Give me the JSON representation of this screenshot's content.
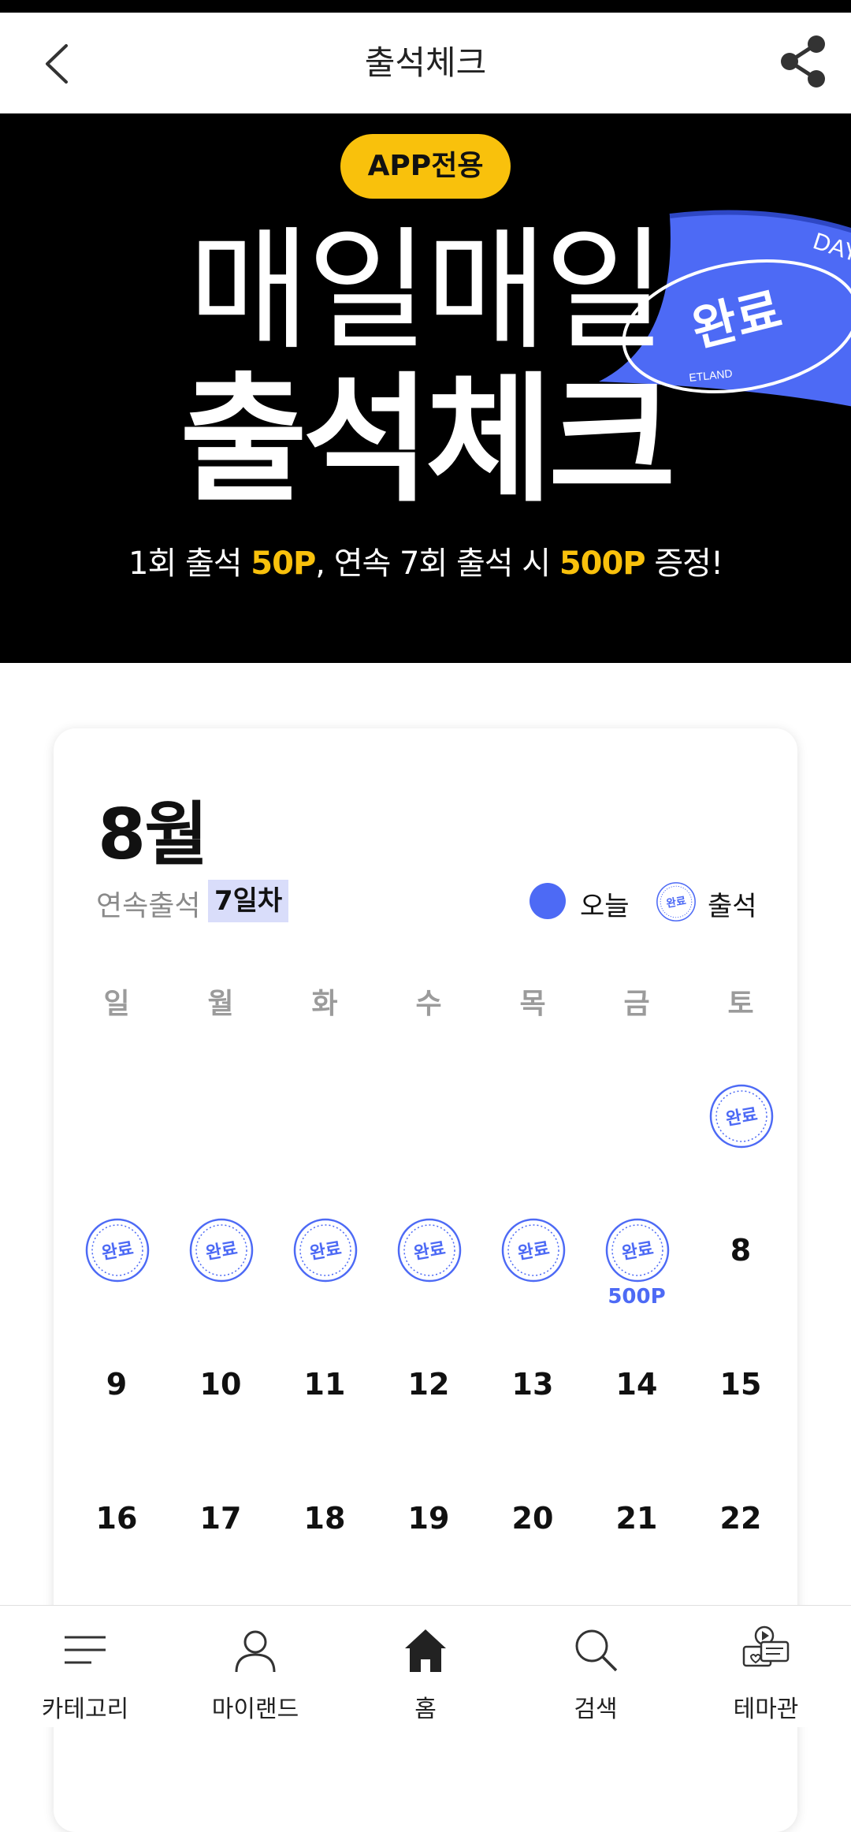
{
  "header": {
    "title": "출석체크"
  },
  "banner": {
    "badge": "APP전용",
    "line1": "매일매일",
    "line2": "출석체크",
    "sub_part1": "1회 출석 ",
    "sub_hl1": "50P",
    "sub_part2": ", 연속 7회 출석 시 ",
    "sub_hl2": "500P",
    "sub_part3": " 증정!",
    "ribbon_text": "DAY",
    "ribbon_stamp": "완료",
    "ribbon_small": "ETLAND"
  },
  "calendar": {
    "month": "8월",
    "streak_label": "연속출석",
    "streak_value": "7일차",
    "legend_today": "오늘",
    "legend_attend": "출석",
    "stamp_text": "완료",
    "weekdays": [
      "일",
      "월",
      "화",
      "수",
      "목",
      "금",
      "토"
    ],
    "reward_label": "500P",
    "days": [
      "8",
      "9",
      "10",
      "11",
      "12",
      "13",
      "14",
      "15",
      "16",
      "17",
      "18",
      "19",
      "20",
      "21",
      "22"
    ]
  },
  "tabbar": {
    "items": [
      "카테고리",
      "마이랜드",
      "홈",
      "검색",
      "테마관"
    ]
  },
  "colors": {
    "accent": "#4d6af5",
    "badge": "#f9c10c",
    "banner_bg": "#000000",
    "streak_bg": "#d9ddfa"
  }
}
